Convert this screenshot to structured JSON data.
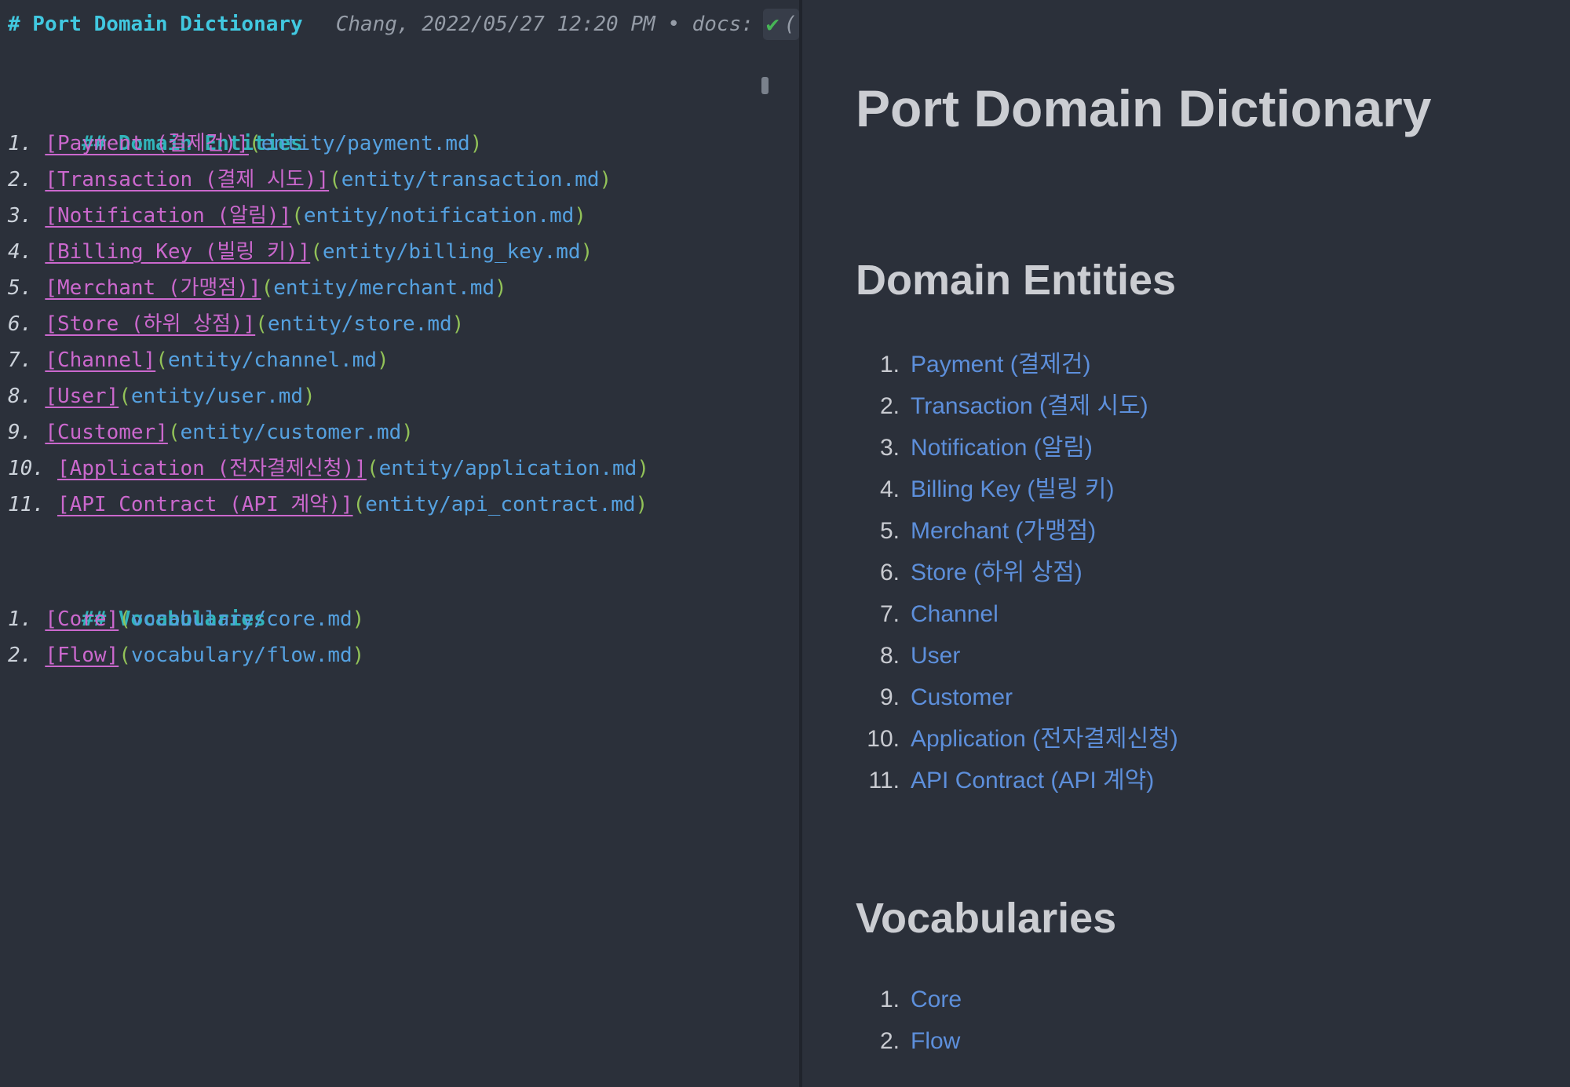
{
  "syntax": {
    "open": "(",
    "close": ")"
  },
  "source": {
    "h1": "# Port Domain Dictionary",
    "h2_entities": "## Domain Entities",
    "h2_vocab": "## Vocabularies"
  },
  "blame": {
    "author_line": "Chang, 2022/05/27 12:20 PM • docs:",
    "check": "✔",
    "trailing": "("
  },
  "preview": {
    "h1": "Port Domain Dictionary",
    "h2_entities": "Domain Entities",
    "h2_vocab": "Vocabularies"
  },
  "entities": [
    {
      "num": "1.",
      "md": "[Payment (결제건)]",
      "path": "entity/payment.md",
      "label": "Payment (결제건)"
    },
    {
      "num": "2.",
      "md": "[Transaction (결제 시도)]",
      "path": "entity/transaction.md",
      "label": "Transaction (결제 시도)"
    },
    {
      "num": "3.",
      "md": "[Notification (알림)]",
      "path": "entity/notification.md",
      "label": "Notification (알림)"
    },
    {
      "num": "4.",
      "md": "[Billing Key (빌링 키)]",
      "path": "entity/billing_key.md",
      "label": "Billing Key (빌링 키)"
    },
    {
      "num": "5.",
      "md": "[Merchant (가맹점)]",
      "path": "entity/merchant.md",
      "label": "Merchant (가맹점)"
    },
    {
      "num": "6.",
      "md": "[Store (하위 상점)]",
      "path": "entity/store.md",
      "label": "Store (하위 상점)"
    },
    {
      "num": "7.",
      "md": "[Channel]",
      "path": "entity/channel.md",
      "label": "Channel"
    },
    {
      "num": "8.",
      "md": "[User]",
      "path": "entity/user.md",
      "label": "User"
    },
    {
      "num": "9.",
      "md": "[Customer]",
      "path": "entity/customer.md",
      "label": "Customer"
    },
    {
      "num": "10.",
      "md": "[Application (전자결제신청)]",
      "path": "entity/application.md",
      "label": "Application (전자결제신청)"
    },
    {
      "num": "11.",
      "md": "[API Contract (API 계약)]",
      "path": "entity/api_contract.md",
      "label": "API Contract (API 계약)"
    }
  ],
  "vocabularies": [
    {
      "num": "1.",
      "md": "[Core]",
      "path": "vocabulary/core.md",
      "label": "Core"
    },
    {
      "num": "2.",
      "md": "[Flow]",
      "path": "vocabulary/flow.md",
      "label": "Flow"
    }
  ]
}
